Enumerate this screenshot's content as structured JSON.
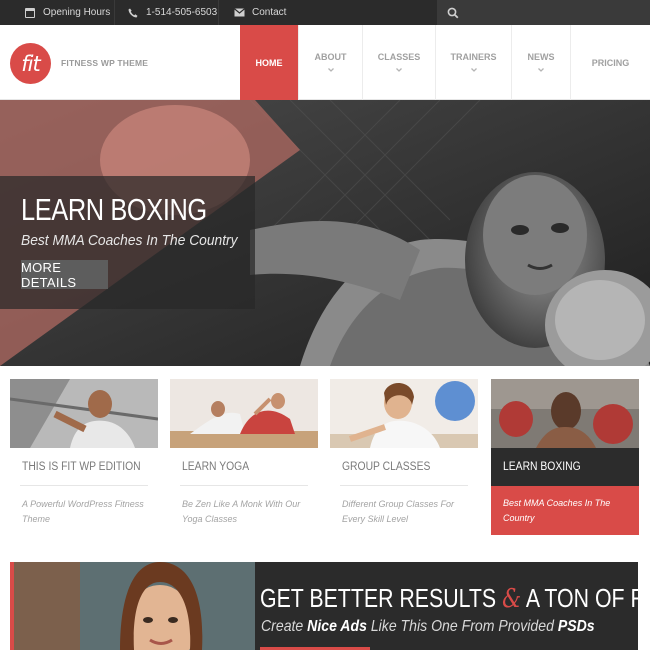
{
  "topbar": {
    "hours_label": "Opening Hours",
    "phone_label": "1-514-505-6503",
    "contact_label": "Contact"
  },
  "header": {
    "logo_text": "fit",
    "tagline": "FITNESS WP THEME",
    "nav": [
      {
        "label": "HOME",
        "active": true
      },
      {
        "label": "ABOUT",
        "active": false
      },
      {
        "label": "CLASSES",
        "active": false
      },
      {
        "label": "TRAINERS",
        "active": false
      },
      {
        "label": "NEWS",
        "active": false
      },
      {
        "label": "PRICING",
        "active": false
      }
    ]
  },
  "hero": {
    "title": "LEARN BOXING",
    "subtitle": "Best MMA Coaches In The Country",
    "button_label": "MORE  DETAILS"
  },
  "cards": [
    {
      "title": "THIS IS FIT WP EDITION",
      "desc": "A Powerful WordPress Fitness Theme"
    },
    {
      "title": "LEARN YOGA",
      "desc": "Be Zen Like A Monk With Our Yoga Classes"
    },
    {
      "title": "GROUP CLASSES",
      "desc": "Different Group Classes For Every Skill Level"
    },
    {
      "title": "LEARN BOXING",
      "desc": "Best MMA Coaches In The Country",
      "highlighted": true
    }
  ],
  "banner": {
    "title_part1": "GET BETTER RESULTS",
    "amp": "&",
    "title_part2": "A TON OF FUN",
    "sub_w1": "Create ",
    "sub_w2": "Nice Ads",
    "sub_w3": " Like This One From Provided ",
    "sub_w4": "PSDs"
  },
  "colors": {
    "accent": "#d94b48",
    "dark": "#2b2b2b"
  }
}
